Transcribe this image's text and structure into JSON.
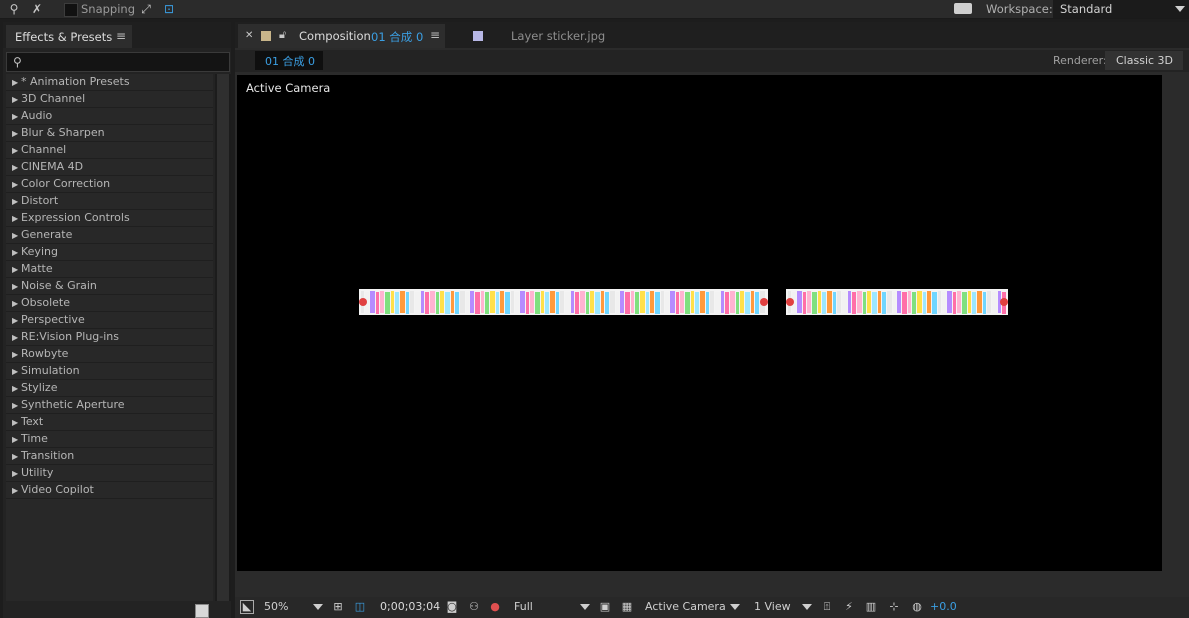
{
  "toolbar": {
    "snapping_label": "Snapping",
    "workspace_label": "Workspace:",
    "workspace_value": "Standard"
  },
  "effects_panel": {
    "tab_label": "Effects & Presets",
    "search_placeholder": "",
    "items": [
      "* Animation Presets",
      "3D Channel",
      "Audio",
      "Blur & Sharpen",
      "Channel",
      "CINEMA 4D",
      "Color Correction",
      "Distort",
      "Expression Controls",
      "Generate",
      "Keying",
      "Matte",
      "Noise & Grain",
      "Obsolete",
      "Perspective",
      "RE:Vision Plug-ins",
      "Rowbyte",
      "Simulation",
      "Stylize",
      "Synthetic Aperture",
      "Text",
      "Time",
      "Transition",
      "Utility",
      "Video Copilot"
    ]
  },
  "composition_panel": {
    "tab_composition_label": "Composition",
    "tab_composition_name": "01 合成 0",
    "tab_layer_label": "Layer  sticker.jpg",
    "comp_name_tab": "01 合成 0",
    "renderer_label": "Renderer:",
    "renderer_value": "Classic 3D",
    "viewer_label": "Active Camera",
    "colors": {
      "accent": "#3b9fe3",
      "comp_swatch": "#c8b58a",
      "layer_swatch": "#b8b8e6"
    }
  },
  "viewer_bar": {
    "zoom": "50%",
    "timecode": "0;00;03;04",
    "resolution": "Full",
    "camera": "Active Camera",
    "view_layout": "1 View",
    "exposure": "+0.0"
  }
}
